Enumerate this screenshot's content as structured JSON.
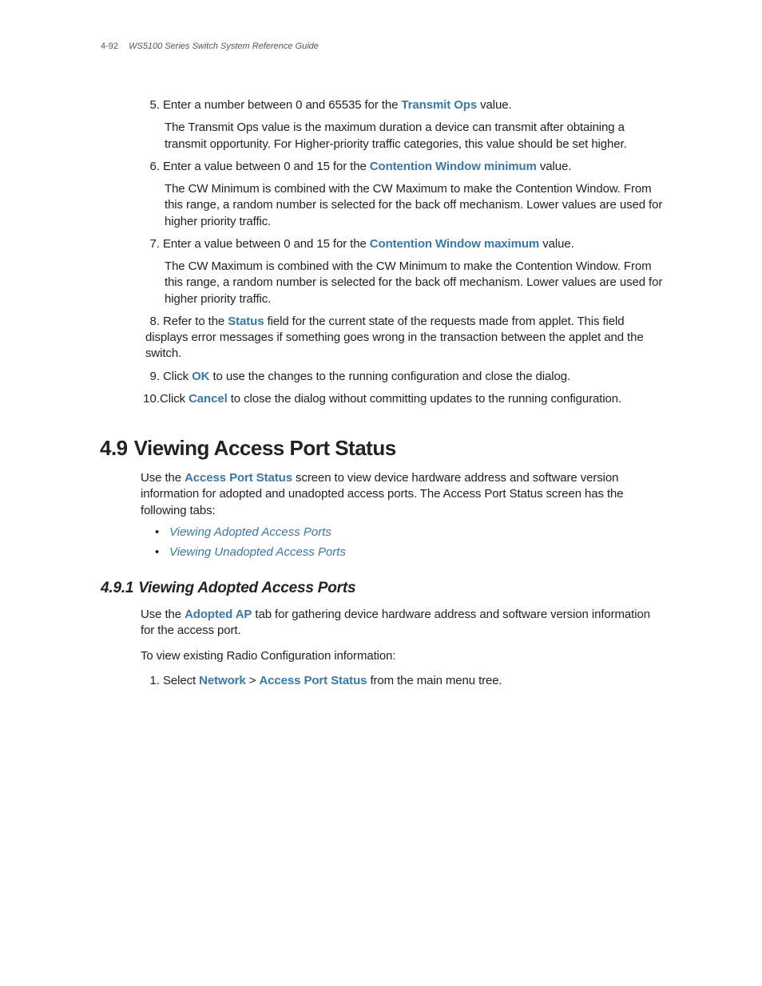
{
  "header": {
    "pageNumber": "4-92",
    "docTitle": "WS5100 Series Switch System Reference Guide"
  },
  "list1": {
    "item5": {
      "num": "5.",
      "p1a": "Enter a number between 0 and 65535 for the ",
      "p1b": "Transmit Ops",
      "p1c": " value.",
      "p2": "The Transmit Ops value is the maximum duration a device can transmit after obtaining a transmit opportunity. For Higher-priority traffic categories, this value should be set higher."
    },
    "item6": {
      "num": "6.",
      "p1a": "Enter a value between 0 and 15 for the ",
      "p1b": "Contention Window minimum",
      "p1c": " value.",
      "p2": "The CW Minimum is combined with the CW Maximum to make the Contention Window. From this range, a random number is selected for the back off mechanism. Lower values are used for higher priority traffic."
    },
    "item7": {
      "num": "7.",
      "p1a": "Enter a value between 0 and 15 for the ",
      "p1b": "Contention Window maximum",
      "p1c": " value.",
      "p2": "The CW Maximum is combined with the CW Minimum to make the Contention Window. From this range, a random number is selected for the back off mechanism. Lower values are used for higher priority traffic."
    },
    "item8": {
      "num": "8.",
      "p1a": "Refer to the ",
      "p1b": "Status",
      "p1c": " field for the current state of the requests made from applet. This field displays error messages if something goes wrong in the transaction between the applet and the switch."
    },
    "item9": {
      "num": "9.",
      "p1a": "Click ",
      "p1b": "OK",
      "p1c": " to use the changes to the running configuration and close the dialog."
    },
    "item10": {
      "num": "10.",
      "p1a": "Click ",
      "p1b": "Cancel",
      "p1c": " to close the dialog without committing updates to the running configuration."
    }
  },
  "section49": {
    "num": "4.9",
    "title": "Viewing Access Port Status",
    "para1a": "Use the ",
    "para1b": "Access Port Status",
    "para1c": " screen to view device hardware address and software version information for adopted and unadopted access ports. The Access Port Status screen has the following tabs:",
    "bullet1": "Viewing Adopted Access Ports",
    "bullet2": "Viewing Unadopted Access Ports"
  },
  "section491": {
    "num": "4.9.1",
    "title": "Viewing Adopted Access Ports",
    "para1a": "Use the ",
    "para1b": "Adopted AP",
    "para1c": " tab for gathering device hardware address and software version information for the access port.",
    "para2": "To view existing Radio Configuration information:",
    "step1": {
      "num": "1.",
      "a": "Select ",
      "b": "Network",
      "c": " > ",
      "d": "Access Port Status",
      "e": " from the main menu tree."
    }
  }
}
